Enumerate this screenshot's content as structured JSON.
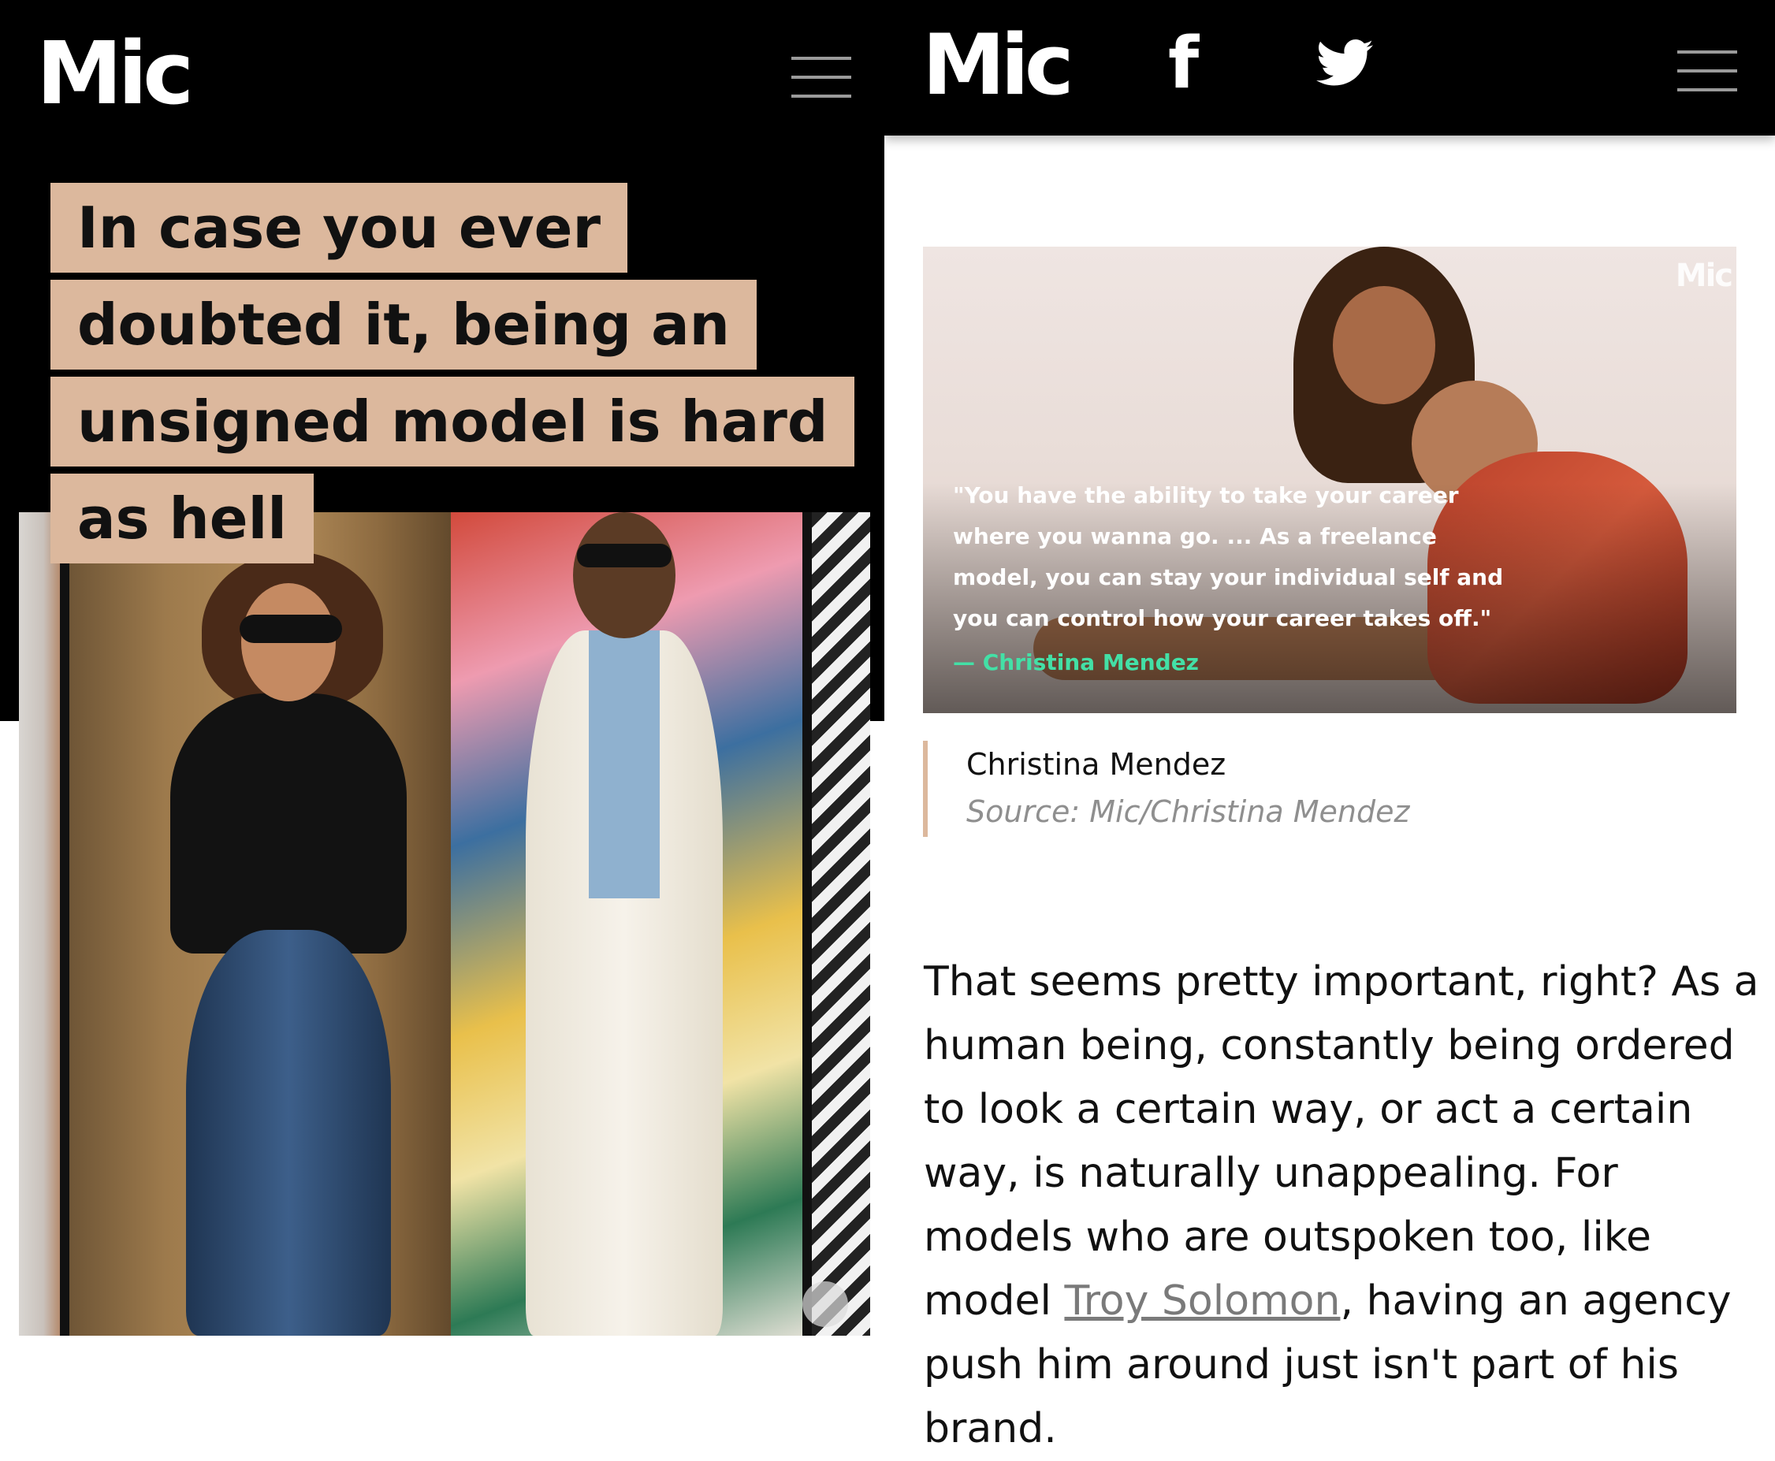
{
  "left": {
    "logo": "Mic",
    "headline_lines": [
      "In case you ever",
      "doubted it, being an",
      "unsigned model is hard",
      "as hell"
    ]
  },
  "right": {
    "logo": "Mic",
    "share_icons": [
      "facebook-icon",
      "twitter-icon"
    ],
    "facebook_glyph": "f",
    "feature_image": {
      "watermark": "Mic",
      "quote_lines": [
        "\"You have the ability to take your career",
        "where you wanna go. ... As a freelance",
        "model, you can stay your individual self and",
        "you can control how your career takes off.\""
      ],
      "attribution": "— Christina Mendez"
    },
    "caption": {
      "name": "Christina Mendez",
      "source": "Source: Mic/Christina Mendez"
    },
    "body": {
      "before_link": "That seems pretty important, right? As a human being, constantly being ordered to look a certain way, or act a certain way, is naturally unappealing. For models who are outspoken too, like model ",
      "link": "Troy Solomon",
      "after_link": ", having an agency push him around just isn't part of his brand."
    }
  },
  "colors": {
    "header_bg": "#000000",
    "headline_highlight": "#dcb89d",
    "attribution_green": "#43e0a6",
    "caption_accent": "#dcb89d",
    "link_gray": "#7a7a7a"
  }
}
